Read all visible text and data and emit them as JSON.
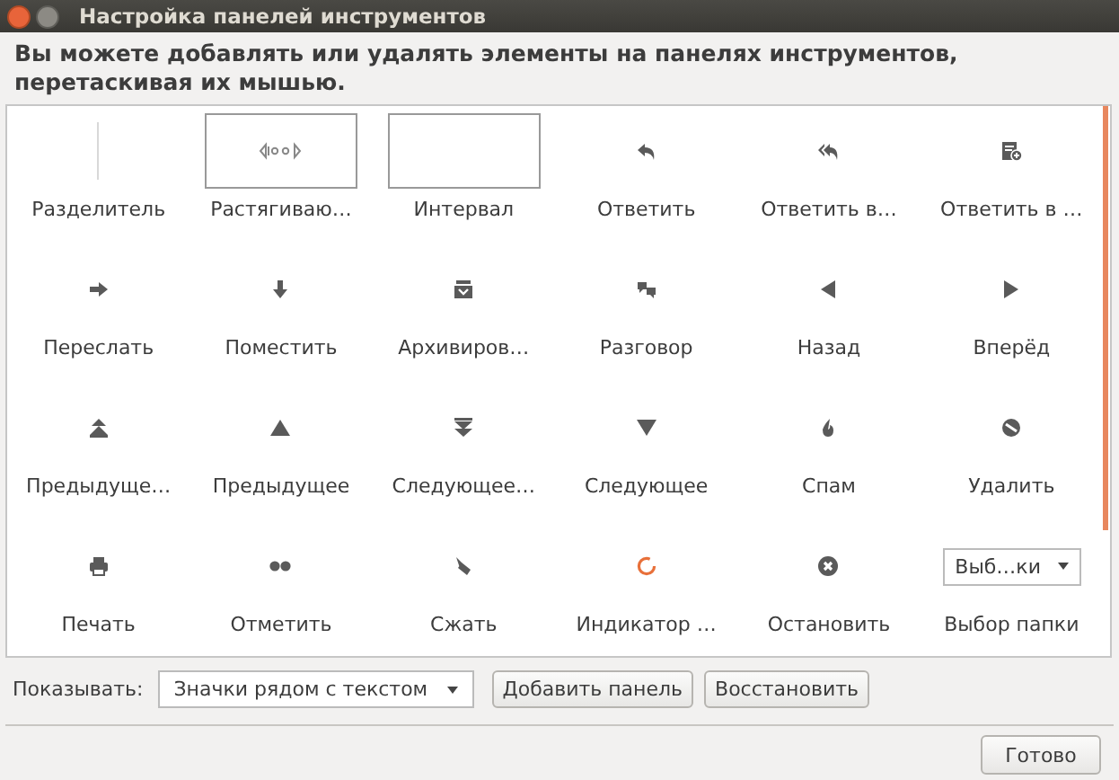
{
  "window": {
    "title": "Настройка панелей инструментов"
  },
  "instruction": "Вы можете добавлять или удалять элементы на панелях инструментов, перетаскивая их мышью.",
  "items": [
    {
      "kind": "separator",
      "label": "Разделитель"
    },
    {
      "kind": "flexible-space",
      "label": "Растягиваю…"
    },
    {
      "kind": "space",
      "label": "Интервал"
    },
    {
      "kind": "button",
      "label": "Ответить"
    },
    {
      "kind": "button",
      "label": "Ответить в…"
    },
    {
      "kind": "button",
      "label": "Ответить в …"
    },
    {
      "kind": "button",
      "label": "Переслать"
    },
    {
      "kind": "button",
      "label": "Поместить"
    },
    {
      "kind": "button",
      "label": "Архивиров…"
    },
    {
      "kind": "button",
      "label": "Разговор"
    },
    {
      "kind": "button",
      "label": "Назад"
    },
    {
      "kind": "button",
      "label": "Вперёд"
    },
    {
      "kind": "button",
      "label": "Предыдуще…"
    },
    {
      "kind": "button",
      "label": "Предыдущее"
    },
    {
      "kind": "button",
      "label": "Следующее…"
    },
    {
      "kind": "button",
      "label": "Следующее"
    },
    {
      "kind": "button",
      "label": "Спам"
    },
    {
      "kind": "button",
      "label": "Удалить"
    },
    {
      "kind": "button",
      "label": "Печать"
    },
    {
      "kind": "button",
      "label": "Отметить"
    },
    {
      "kind": "button",
      "label": "Сжать"
    },
    {
      "kind": "spinner",
      "label": "Индикатор …"
    },
    {
      "kind": "button",
      "label": "Остановить"
    },
    {
      "kind": "combo",
      "value": "Выб…ки",
      "label": "Выбор папки"
    }
  ],
  "show": {
    "label": "Показывать:",
    "value": "Значки рядом с текстом"
  },
  "buttons": [
    "Добавить панель",
    "Восстановить"
  ],
  "done": "Готово"
}
